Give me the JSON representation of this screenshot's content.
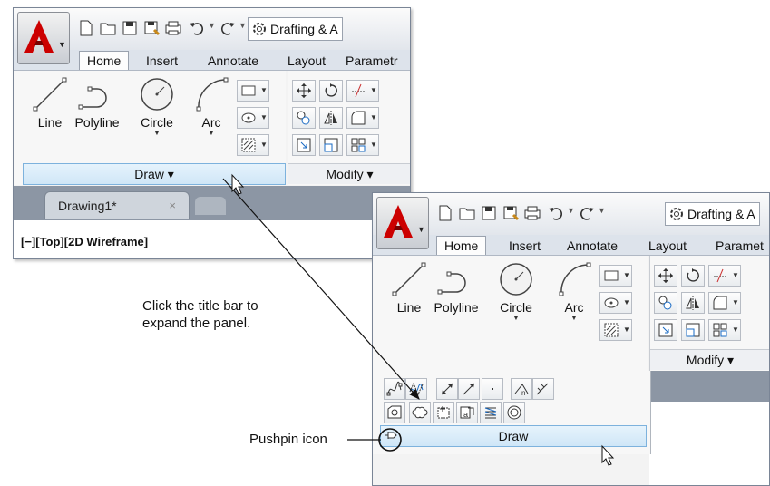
{
  "app": {
    "workspace_label": "Drafting & A",
    "workspace_label_2": "Drafting & A",
    "tabs": [
      "Home",
      "Insert",
      "Annotate",
      "Layout",
      "Parametr"
    ],
    "tabs_2": [
      "Home",
      "Insert",
      "Annotate",
      "Layout",
      "Paramet"
    ],
    "accent_color": "#cc0000",
    "highlight_color": "#cfe6f7"
  },
  "draw_panel": {
    "tools": [
      "Line",
      "Polyline",
      "Circle",
      "Arc"
    ],
    "title": "Draw",
    "title_arrow": "▾"
  },
  "modify_panel": {
    "title": "Modify",
    "title_arrow": "▾"
  },
  "document": {
    "tab_label": "Drawing1*",
    "close_glyph": "×",
    "viewport_label": "[−][Top][2D Wireframe]"
  },
  "callouts": {
    "expand_line1": "Click the title bar to",
    "expand_line2": "expand the panel.",
    "pushpin": "Pushpin icon"
  },
  "icons": [
    "application-menu-icon",
    "new-icon",
    "open-icon",
    "save-icon",
    "save-as-icon",
    "plot-icon",
    "undo-icon",
    "redo-icon",
    "workspace-gear-icon",
    "pushpin-icon"
  ]
}
